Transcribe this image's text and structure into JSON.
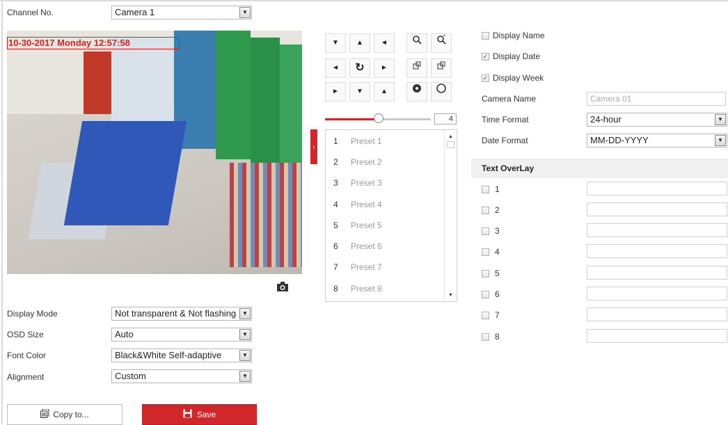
{
  "channel": {
    "label": "Channel No.",
    "value": "Camera 1"
  },
  "video": {
    "osd_text": "10-30-2017 Monday 12:57:58"
  },
  "ptz": {
    "arrows": [
      "▼",
      "▲",
      "◄",
      "◄",
      "↻",
      "►",
      "►",
      "▼",
      "◄"
    ],
    "zoom_value": "4",
    "presets": [
      {
        "num": "1",
        "name": "Preset 1"
      },
      {
        "num": "2",
        "name": "Preset 2"
      },
      {
        "num": "3",
        "name": "Preset 3"
      },
      {
        "num": "4",
        "name": "Preset 4"
      },
      {
        "num": "5",
        "name": "Preset 5"
      },
      {
        "num": "6",
        "name": "Preset 6"
      },
      {
        "num": "7",
        "name": "Preset 7"
      },
      {
        "num": "8",
        "name": "Preset 8"
      }
    ]
  },
  "display": {
    "display_name": "Display Name",
    "display_date": "Display Date",
    "display_week": "Display Week",
    "camera_name_label": "Camera Name",
    "camera_name_placeholder": "Camera 01",
    "time_format_label": "Time Format",
    "time_format_value": "24-hour",
    "date_format_label": "Date Format",
    "date_format_value": "MM-DD-YYYY"
  },
  "text_overlay": {
    "title": "Text OverLay",
    "rows": [
      "1",
      "2",
      "3",
      "4",
      "5",
      "6",
      "7",
      "8"
    ]
  },
  "settings": {
    "display_mode_label": "Display Mode",
    "display_mode_value": "Not transparent & Not flashing",
    "osd_size_label": "OSD Size",
    "osd_size_value": "Auto",
    "font_color_label": "Font Color",
    "font_color_value": "Black&White Self-adaptive",
    "alignment_label": "Alignment",
    "alignment_value": "Custom"
  },
  "buttons": {
    "copy": "Copy to...",
    "save": "Save"
  },
  "colors": {
    "accent": "#d2272a",
    "osd": "#e02020"
  }
}
